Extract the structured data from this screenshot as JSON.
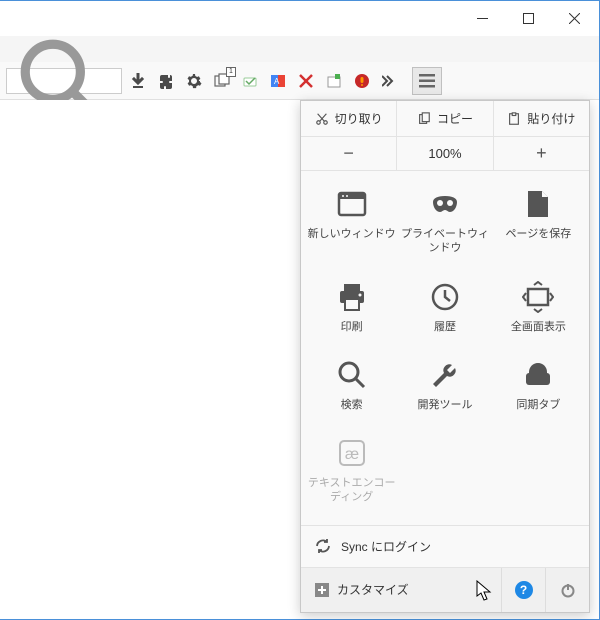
{
  "window": {
    "min": "minimize",
    "max": "maximize",
    "close": "close"
  },
  "search": {
    "placeholder": "検索"
  },
  "toolbar": {
    "badge": "1"
  },
  "menu": {
    "cut": "切り取り",
    "copy": "コピー",
    "paste": "貼り付け",
    "zoom_minus": "−",
    "zoom_value": "100%",
    "zoom_plus": "+",
    "items": [
      {
        "id": "new-window",
        "label": "新しいウィンドウ"
      },
      {
        "id": "private-window",
        "label": "プライベートウィンドウ"
      },
      {
        "id": "save-page",
        "label": "ページを保存"
      },
      {
        "id": "print",
        "label": "印刷"
      },
      {
        "id": "history",
        "label": "履歴"
      },
      {
        "id": "fullscreen",
        "label": "全画面表示"
      },
      {
        "id": "find",
        "label": "検索"
      },
      {
        "id": "devtools",
        "label": "開発ツール"
      },
      {
        "id": "sync-tabs",
        "label": "同期タブ"
      },
      {
        "id": "text-encoding",
        "label": "テキストエンコーディング"
      }
    ],
    "sync": "Sync にログイン",
    "customize": "カスタマイズ",
    "help": "?"
  }
}
